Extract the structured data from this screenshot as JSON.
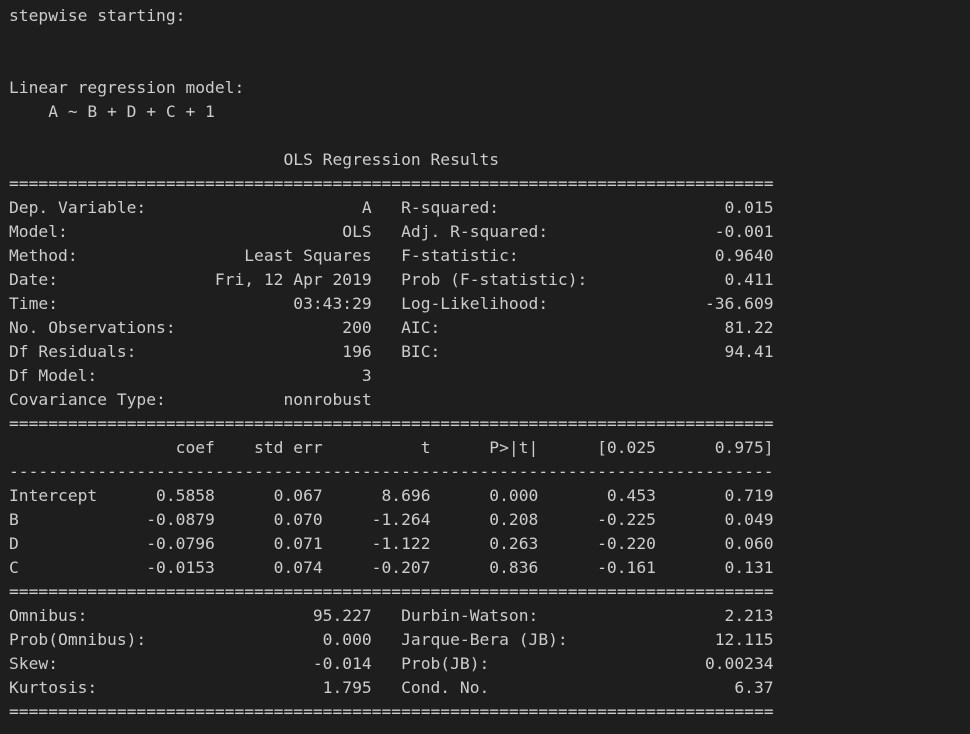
{
  "console": {
    "lines": [
      "stepwise starting:",
      "",
      "",
      "Linear regression model:",
      "    A ~ B + D + C + 1",
      "",
      "                            OLS Regression Results                            ",
      "==============================================================================",
      "Dep. Variable:                      A   R-squared:                       0.015",
      "Model:                            OLS   Adj. R-squared:                 -0.001",
      "Method:                 Least Squares   F-statistic:                    0.9640",
      "Date:                Fri, 12 Apr 2019   Prob (F-statistic):              0.411",
      "Time:                        03:43:29   Log-Likelihood:                -36.609",
      "No. Observations:                 200   AIC:                             81.22",
      "Df Residuals:                     196   BIC:                             94.41",
      "Df Model:                           3                                         ",
      "Covariance Type:            nonrobust                                         ",
      "==============================================================================",
      "                 coef    std err          t      P>|t|      [0.025      0.975]",
      "------------------------------------------------------------------------------",
      "Intercept      0.5858      0.067      8.696      0.000       0.453       0.719",
      "B             -0.0879      0.070     -1.264      0.208      -0.225       0.049",
      "D             -0.0796      0.071     -1.122      0.263      -0.220       0.060",
      "C             -0.0153      0.074     -0.207      0.836      -0.161       0.131",
      "==============================================================================",
      "Omnibus:                       95.227   Durbin-Watson:                   2.213",
      "Prob(Omnibus):                  0.000   Jarque-Bera (JB):               12.115",
      "Skew:                          -0.014   Prob(JB):                      0.00234",
      "Kurtosis:                       1.795   Cond. No.                         6.37",
      "=============================================================================="
    ]
  }
}
